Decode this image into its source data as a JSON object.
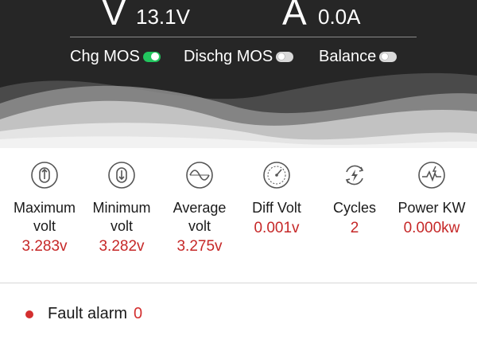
{
  "header": {
    "voltage_symbol": "V",
    "voltage_value": "13.1V",
    "current_symbol": "A",
    "current_value": "0.0A"
  },
  "switches": [
    {
      "label": "Chg MOS",
      "state": "on"
    },
    {
      "label": "Dischg MOS",
      "state": "off"
    },
    {
      "label": "Balance",
      "state": "off"
    }
  ],
  "stats": [
    {
      "icon": "max-volt-icon",
      "label_line1": "Maximum",
      "label_line2": "volt",
      "value": "3.283v"
    },
    {
      "icon": "min-volt-icon",
      "label_line1": "Minimum",
      "label_line2": "volt",
      "value": "3.282v"
    },
    {
      "icon": "avg-volt-icon",
      "label_line1": "Average",
      "label_line2": "volt",
      "value": "3.275v"
    },
    {
      "icon": "gauge-icon",
      "label_line1": "Diff Volt",
      "label_line2": "",
      "value": "0.001v"
    },
    {
      "icon": "cycle-icon",
      "label_line1": "Cycles",
      "label_line2": "",
      "value": "2"
    },
    {
      "icon": "power-icon",
      "label_line1": "Power KW",
      "label_line2": "",
      "value": "0.000kw"
    }
  ],
  "fault": {
    "label": "Fault alarm",
    "count": "0"
  },
  "colors": {
    "accent_red": "#c62828",
    "toggle_on": "#22c55e",
    "header_bg": "#262626"
  }
}
